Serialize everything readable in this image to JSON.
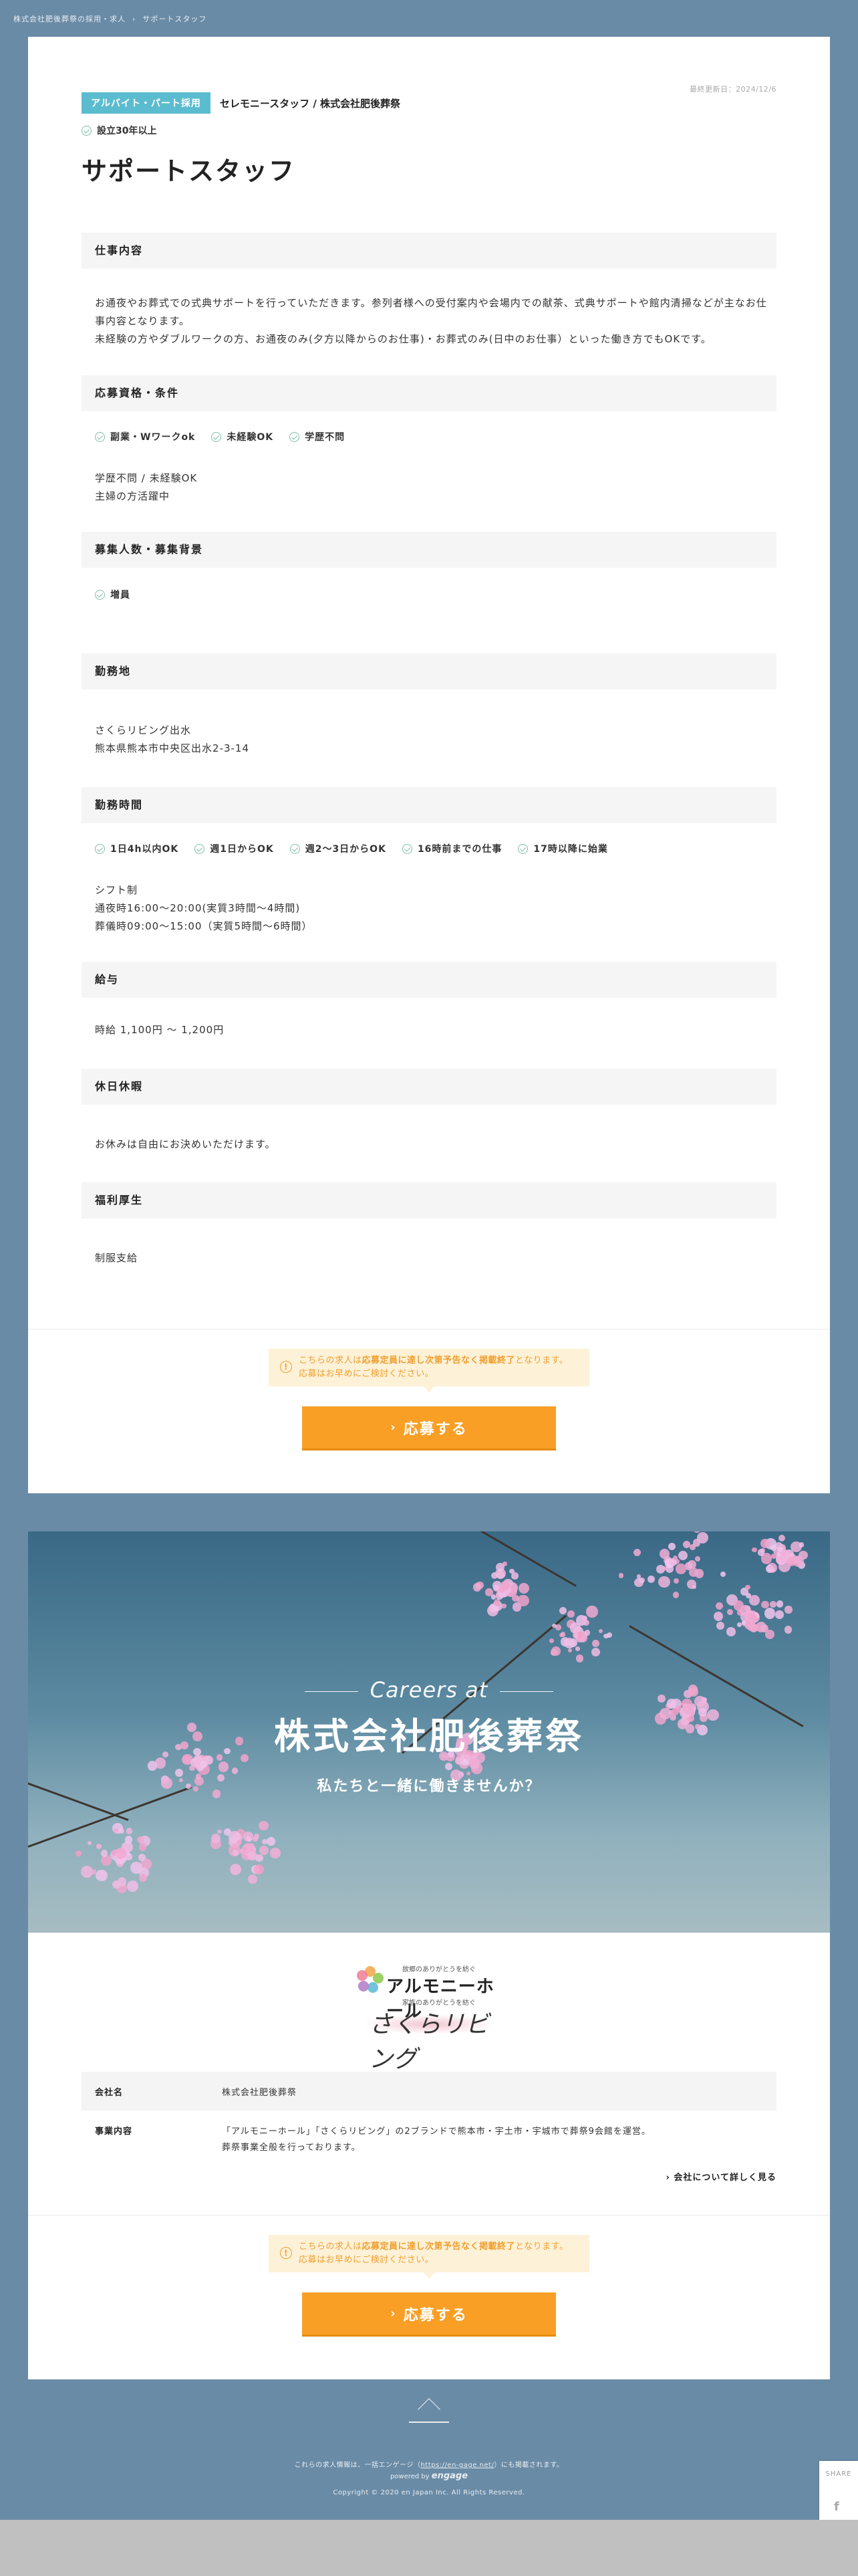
{
  "breadcrumb": {
    "items": [
      "株式会社肥後葬祭の採用・求人",
      "サポートスタッフ"
    ],
    "separator": "›"
  },
  "job": {
    "updated": "最終更新日：2024/12/6",
    "employment_type": "アルバイト・パート採用",
    "company_line": "セレモニースタッフ / 株式会社肥後葬祭",
    "established": "設立30年以上",
    "title": "サポートスタッフ",
    "sections": {
      "work": {
        "heading": "仕事内容",
        "lines": [
          "お通夜やお葬式での式典サポートを行っていただきます。参列者様への受付案内や会場内での献茶、式典サポートや館内清掃などが主なお仕事内容となります。",
          "未経験の方やダブルワークの方、お通夜のみ(夕方以降からのお仕事)・お葬式のみ(日中のお仕事）といった働き方でもOKです。"
        ]
      },
      "requirements": {
        "heading": "応募資格・条件",
        "chips": [
          "副業・Wワークok",
          "未経験OK",
          "学歴不問"
        ],
        "lines": [
          "学歴不問 / 未経験OK",
          "主婦の方活躍中"
        ]
      },
      "recruit": {
        "heading": "募集人数・募集背景",
        "chips": [
          "増員"
        ]
      },
      "location": {
        "heading": "勤務地",
        "lines": [
          "さくらリビング出水",
          "熊本県熊本市中央区出水2-3-14"
        ]
      },
      "hours": {
        "heading": "勤務時間",
        "chips": [
          "1日4h以内OK",
          "週1日からOK",
          "週2～3日からOK",
          "16時前までの仕事",
          "17時以降に始業"
        ],
        "lines": [
          "シフト制",
          "通夜時16:00～20:00(実質3時間～4時間)",
          "葬儀時09:00～15:00（実質5時間～6時間）"
        ]
      },
      "salary": {
        "heading": "給与",
        "lines": [
          "時給 1,100円 〜 1,200円"
        ]
      },
      "holidays": {
        "heading": "休日休暇",
        "lines": [
          "お休みは自由にお決めいただけます。"
        ]
      },
      "benefits": {
        "heading": "福利厚生",
        "lines": [
          "制服支給"
        ]
      }
    }
  },
  "notice": {
    "prefix": "こちらの求人は",
    "highlight": "応募定員に達し次第予告なく掲載終了",
    "suffix": "となります。",
    "line2": "応募はお早めにご検討ください。"
  },
  "apply_button": {
    "label": "応募する",
    "icon": "chevron-right-icon"
  },
  "company": {
    "careers_at": "Careers at",
    "name": "株式会社肥後葬祭",
    "tagline": "私たちと一緒に働きませんか？",
    "logo": {
      "sub1": "故郷のありがとうを紡ぐ",
      "main1": "アルモニーホール",
      "sub2": "家族のありがとうを紡ぐ",
      "main2": "さくらリビング"
    },
    "table": [
      {
        "label": "会社名",
        "value_lines": [
          "株式会社肥後葬祭"
        ]
      },
      {
        "label": "事業内容",
        "value_lines": [
          "「アルモニーホール」「さくらリビング」の2ブランドで熊本市・宇土市・宇城市で葬祭9会館を運営。",
          "葬祭事業全般を行っております。"
        ]
      }
    ],
    "more_link": "会社について詳しく見る"
  },
  "footer": {
    "listing_prefix": "これらの求人情報は、一括エンゲージ（",
    "listing_url": "https://en-gage.net/",
    "listing_suffix": "）にも掲載されます。",
    "powered_by": "powered by",
    "brand": "engage",
    "copyright": "Copyright © 2020 en Japan Inc. All Rights Reserved."
  },
  "share": {
    "label": "SHARE",
    "facebook": "f",
    "twitter": "🐦"
  },
  "colors": {
    "background": "#6a8ba6",
    "badge": "#5cbccf",
    "apply": "#f99f26",
    "notice_bg": "#fdf1d7",
    "notice_text": "#f0a030"
  }
}
